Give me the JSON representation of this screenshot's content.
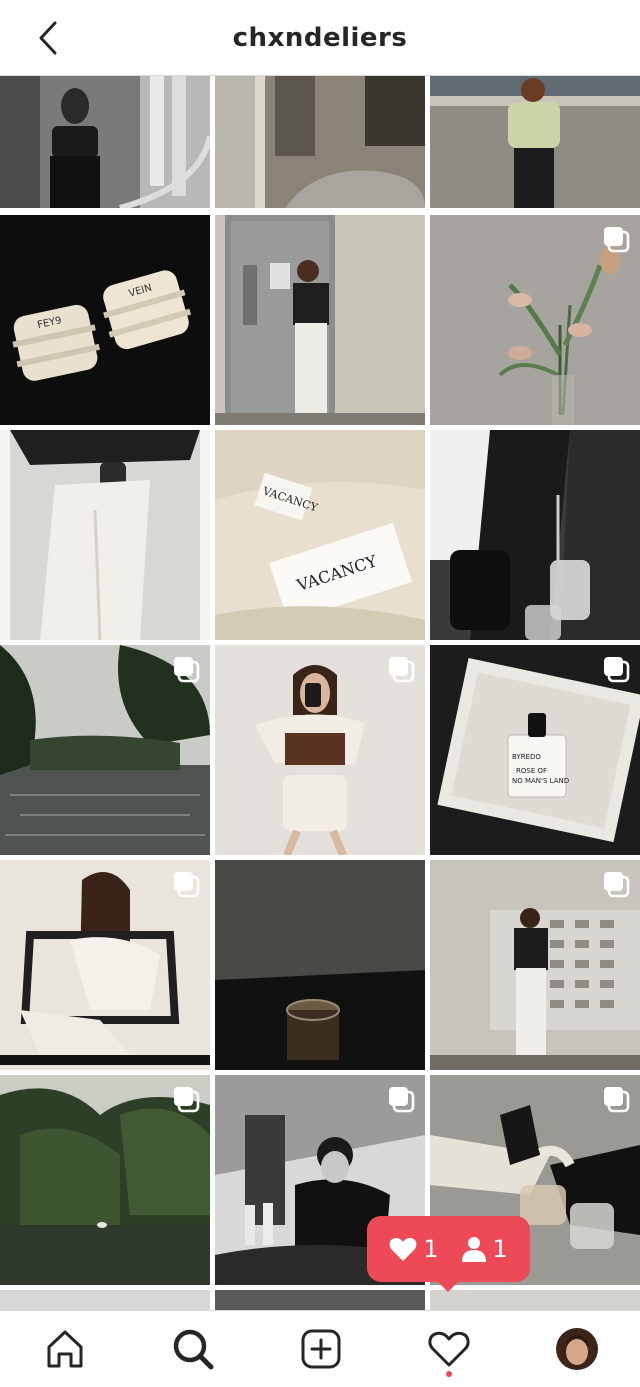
{
  "header": {
    "title": "chxndeliers",
    "back_icon": "chevron-left-icon"
  },
  "posts": [
    {
      "desc": "mirror selfie in black outfit",
      "multi": false
    },
    {
      "desc": "bedroom with city window",
      "multi": false
    },
    {
      "desc": "woman in green top on rooftop",
      "multi": false
    },
    {
      "desc": "FEY9 and VEIN candles on black",
      "multi": false
    },
    {
      "desc": "woman at grey door with number 4",
      "multi": false
    },
    {
      "desc": "tulips in glass vase",
      "multi": true
    },
    {
      "desc": "white trousers with iced drink",
      "multi": false
    },
    {
      "desc": "VACANCY clothing tag",
      "multi": false
    },
    {
      "desc": "couple black and white with drinks",
      "multi": false
    },
    {
      "desc": "river with trees",
      "multi": true
    },
    {
      "desc": "mirror selfie in white shorts",
      "multi": true
    },
    {
      "desc": "BYREDO Rose of No Man's Land perfume",
      "multi": true
    },
    {
      "desc": "woman on black chair",
      "multi": true
    },
    {
      "desc": "iced coffee in dark light",
      "multi": false
    },
    {
      "desc": "woman by patterned wall",
      "multi": true
    },
    {
      "desc": "lake with swan and trees",
      "multi": true
    },
    {
      "desc": "woman at dinner table black and white",
      "multi": true
    },
    {
      "desc": "boots and iced drinks",
      "multi": true
    }
  ],
  "notification": {
    "likes": "1",
    "followers": "1",
    "like_icon": "heart-icon",
    "follower_icon": "person-icon"
  },
  "tabbar": {
    "items": [
      "home-icon",
      "search-icon",
      "add-post-icon",
      "activity-heart-icon",
      "profile-avatar"
    ],
    "active": "search"
  }
}
